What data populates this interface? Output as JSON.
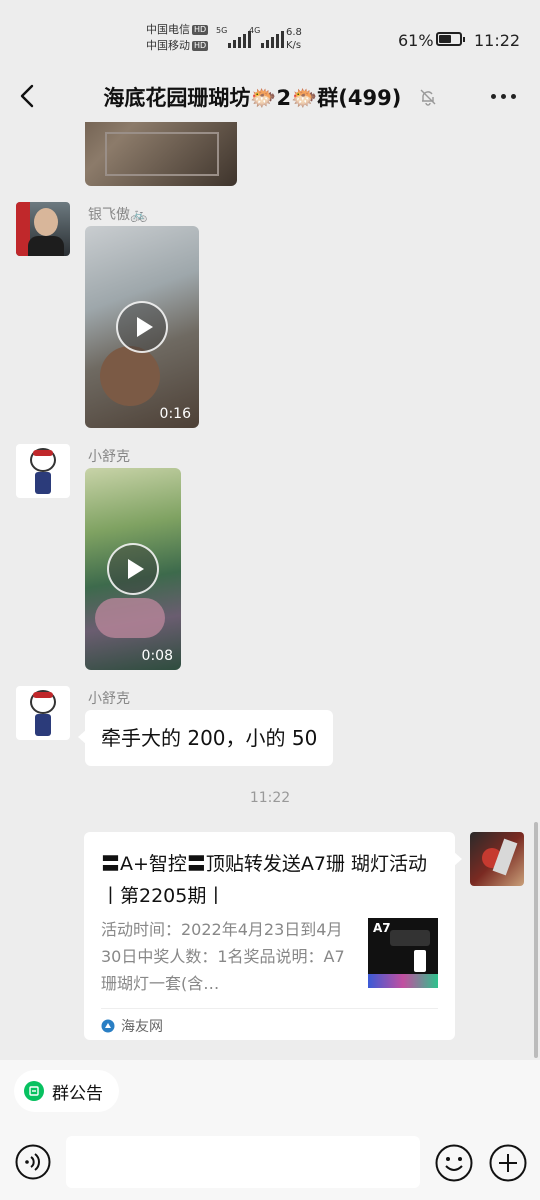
{
  "status_bar": {
    "carrier_1": "中国电信",
    "carrier_2": "中国移动",
    "hd_badge": "HD",
    "network_1": "5G",
    "network_2": "4G",
    "speed_value": "6.8",
    "speed_unit": "K/s",
    "battery_percent": "61%",
    "battery_level": 0.61,
    "time": "11:22"
  },
  "header": {
    "title": "海底花园珊瑚坊🐡2🐡群(499)",
    "back_icon": "chevron-left-icon",
    "mute_icon": "bell-off-icon",
    "more_icon": "more-dots-icon"
  },
  "messages": [
    {
      "type": "video",
      "sender": "",
      "partial": true
    },
    {
      "type": "video",
      "sender": "银飞傲🚲",
      "duration": "0:16"
    },
    {
      "type": "video",
      "sender": "小舒克",
      "duration": "0:08"
    },
    {
      "type": "text",
      "sender": "小舒克",
      "text": "牵手大的 200，小的 50"
    },
    {
      "type": "timestamp",
      "text": "11:22"
    },
    {
      "type": "link_card",
      "title": "〓A+智控〓顶贴转发送A7珊 瑚灯活动丨第2205期丨",
      "description": "活动时间：2022年4月23日到4月30日中奖人数：1名奖品说明：A7珊瑚灯一套(含…",
      "thumb_label": "A7",
      "source": "海友网"
    }
  ],
  "bottom_bar": {
    "notice_label": "群公告",
    "voice_icon": "voice-icon",
    "emoji_icon": "emoji-icon",
    "plus_icon": "plus-circle-icon",
    "input_value": ""
  }
}
